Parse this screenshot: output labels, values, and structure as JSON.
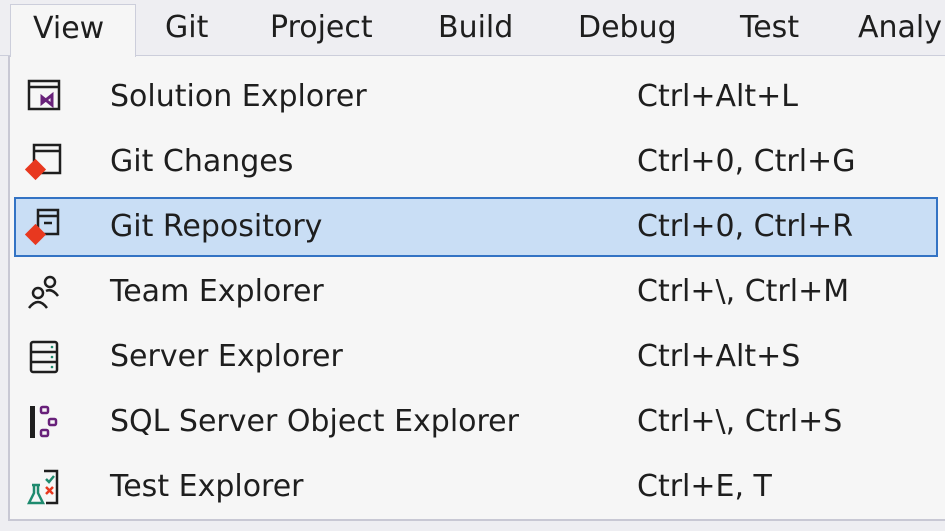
{
  "menubar": {
    "items": [
      {
        "label": "View"
      },
      {
        "label": "Git"
      },
      {
        "label": "Project"
      },
      {
        "label": "Build"
      },
      {
        "label": "Debug"
      },
      {
        "label": "Test"
      },
      {
        "label": "Analy"
      }
    ]
  },
  "menu": {
    "items": [
      {
        "label": "Solution Explorer",
        "shortcut": "Ctrl+Alt+L",
        "icon": "solution-explorer-icon"
      },
      {
        "label": "Git Changes",
        "shortcut": "Ctrl+0, Ctrl+G",
        "icon": "git-changes-icon"
      },
      {
        "label": "Git Repository",
        "shortcut": "Ctrl+0, Ctrl+R",
        "icon": "git-repository-icon",
        "highlighted": true
      },
      {
        "label": "Team Explorer",
        "shortcut": "Ctrl+\\, Ctrl+M",
        "icon": "team-explorer-icon"
      },
      {
        "label": "Server Explorer",
        "shortcut": "Ctrl+Alt+S",
        "icon": "server-explorer-icon"
      },
      {
        "label": "SQL Server Object Explorer",
        "shortcut": "Ctrl+\\, Ctrl+S",
        "icon": "sql-server-object-explorer-icon"
      },
      {
        "label": "Test Explorer",
        "shortcut": "Ctrl+E, T",
        "icon": "test-explorer-icon"
      }
    ]
  },
  "colors": {
    "highlight_bg": "#c9def5",
    "highlight_border": "#3373c4",
    "vs_purple": "#68217a",
    "git_red": "#e8381f"
  }
}
